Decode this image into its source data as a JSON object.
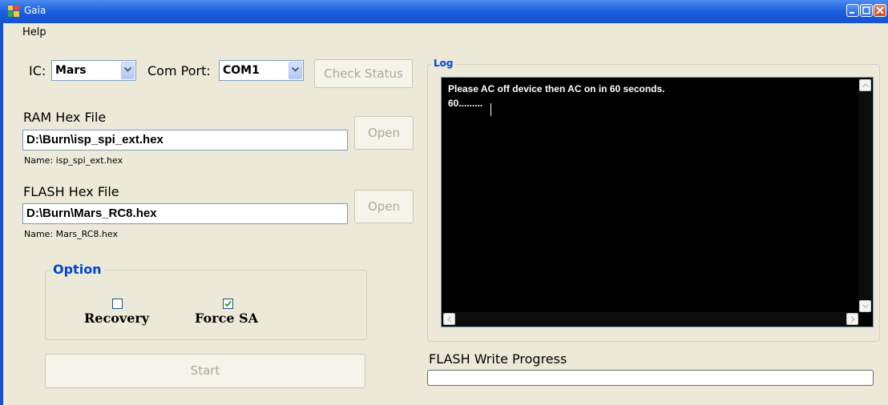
{
  "window": {
    "title": "Gaia"
  },
  "menu": {
    "items": [
      {
        "label": "Help"
      }
    ]
  },
  "ic": {
    "label": "IC:",
    "value": "Mars"
  },
  "com_port": {
    "label": "Com Port:",
    "value": "COM1"
  },
  "check_status": {
    "label": "Check Status"
  },
  "ram": {
    "label": "RAM Hex File",
    "path": "D:\\Burn\\isp_spi_ext.hex",
    "name_text": "Name: isp_spi_ext.hex",
    "open_label": "Open"
  },
  "flash": {
    "label": "FLASH Hex File",
    "path": "D:\\Burn\\Mars_RC8.hex",
    "name_text": "Name: Mars_RC8.hex",
    "open_label": "Open"
  },
  "option": {
    "title": "Option",
    "recovery": {
      "label": "Recovery",
      "checked": false
    },
    "force_sa": {
      "label": "Force SA",
      "checked": true
    }
  },
  "start": {
    "label": "Start"
  },
  "log": {
    "title": "Log",
    "lines": [
      "Please AC off device then AC on in 60 seconds.",
      "60........."
    ]
  },
  "flash_progress": {
    "label": "FLASH Write Progress",
    "value": 0
  },
  "colors": {
    "titlebar": "#1652d0",
    "group_title": "#0046d5",
    "log_background": "#000000",
    "log_text": "#ffffff"
  },
  "icons": [
    "app-icon",
    "minimize-icon",
    "maximize-icon",
    "close-icon",
    "dropdown-arrow-icon",
    "checkmark-icon",
    "scroll-up-icon",
    "scroll-down-icon",
    "scroll-left-icon",
    "scroll-right-icon"
  ]
}
